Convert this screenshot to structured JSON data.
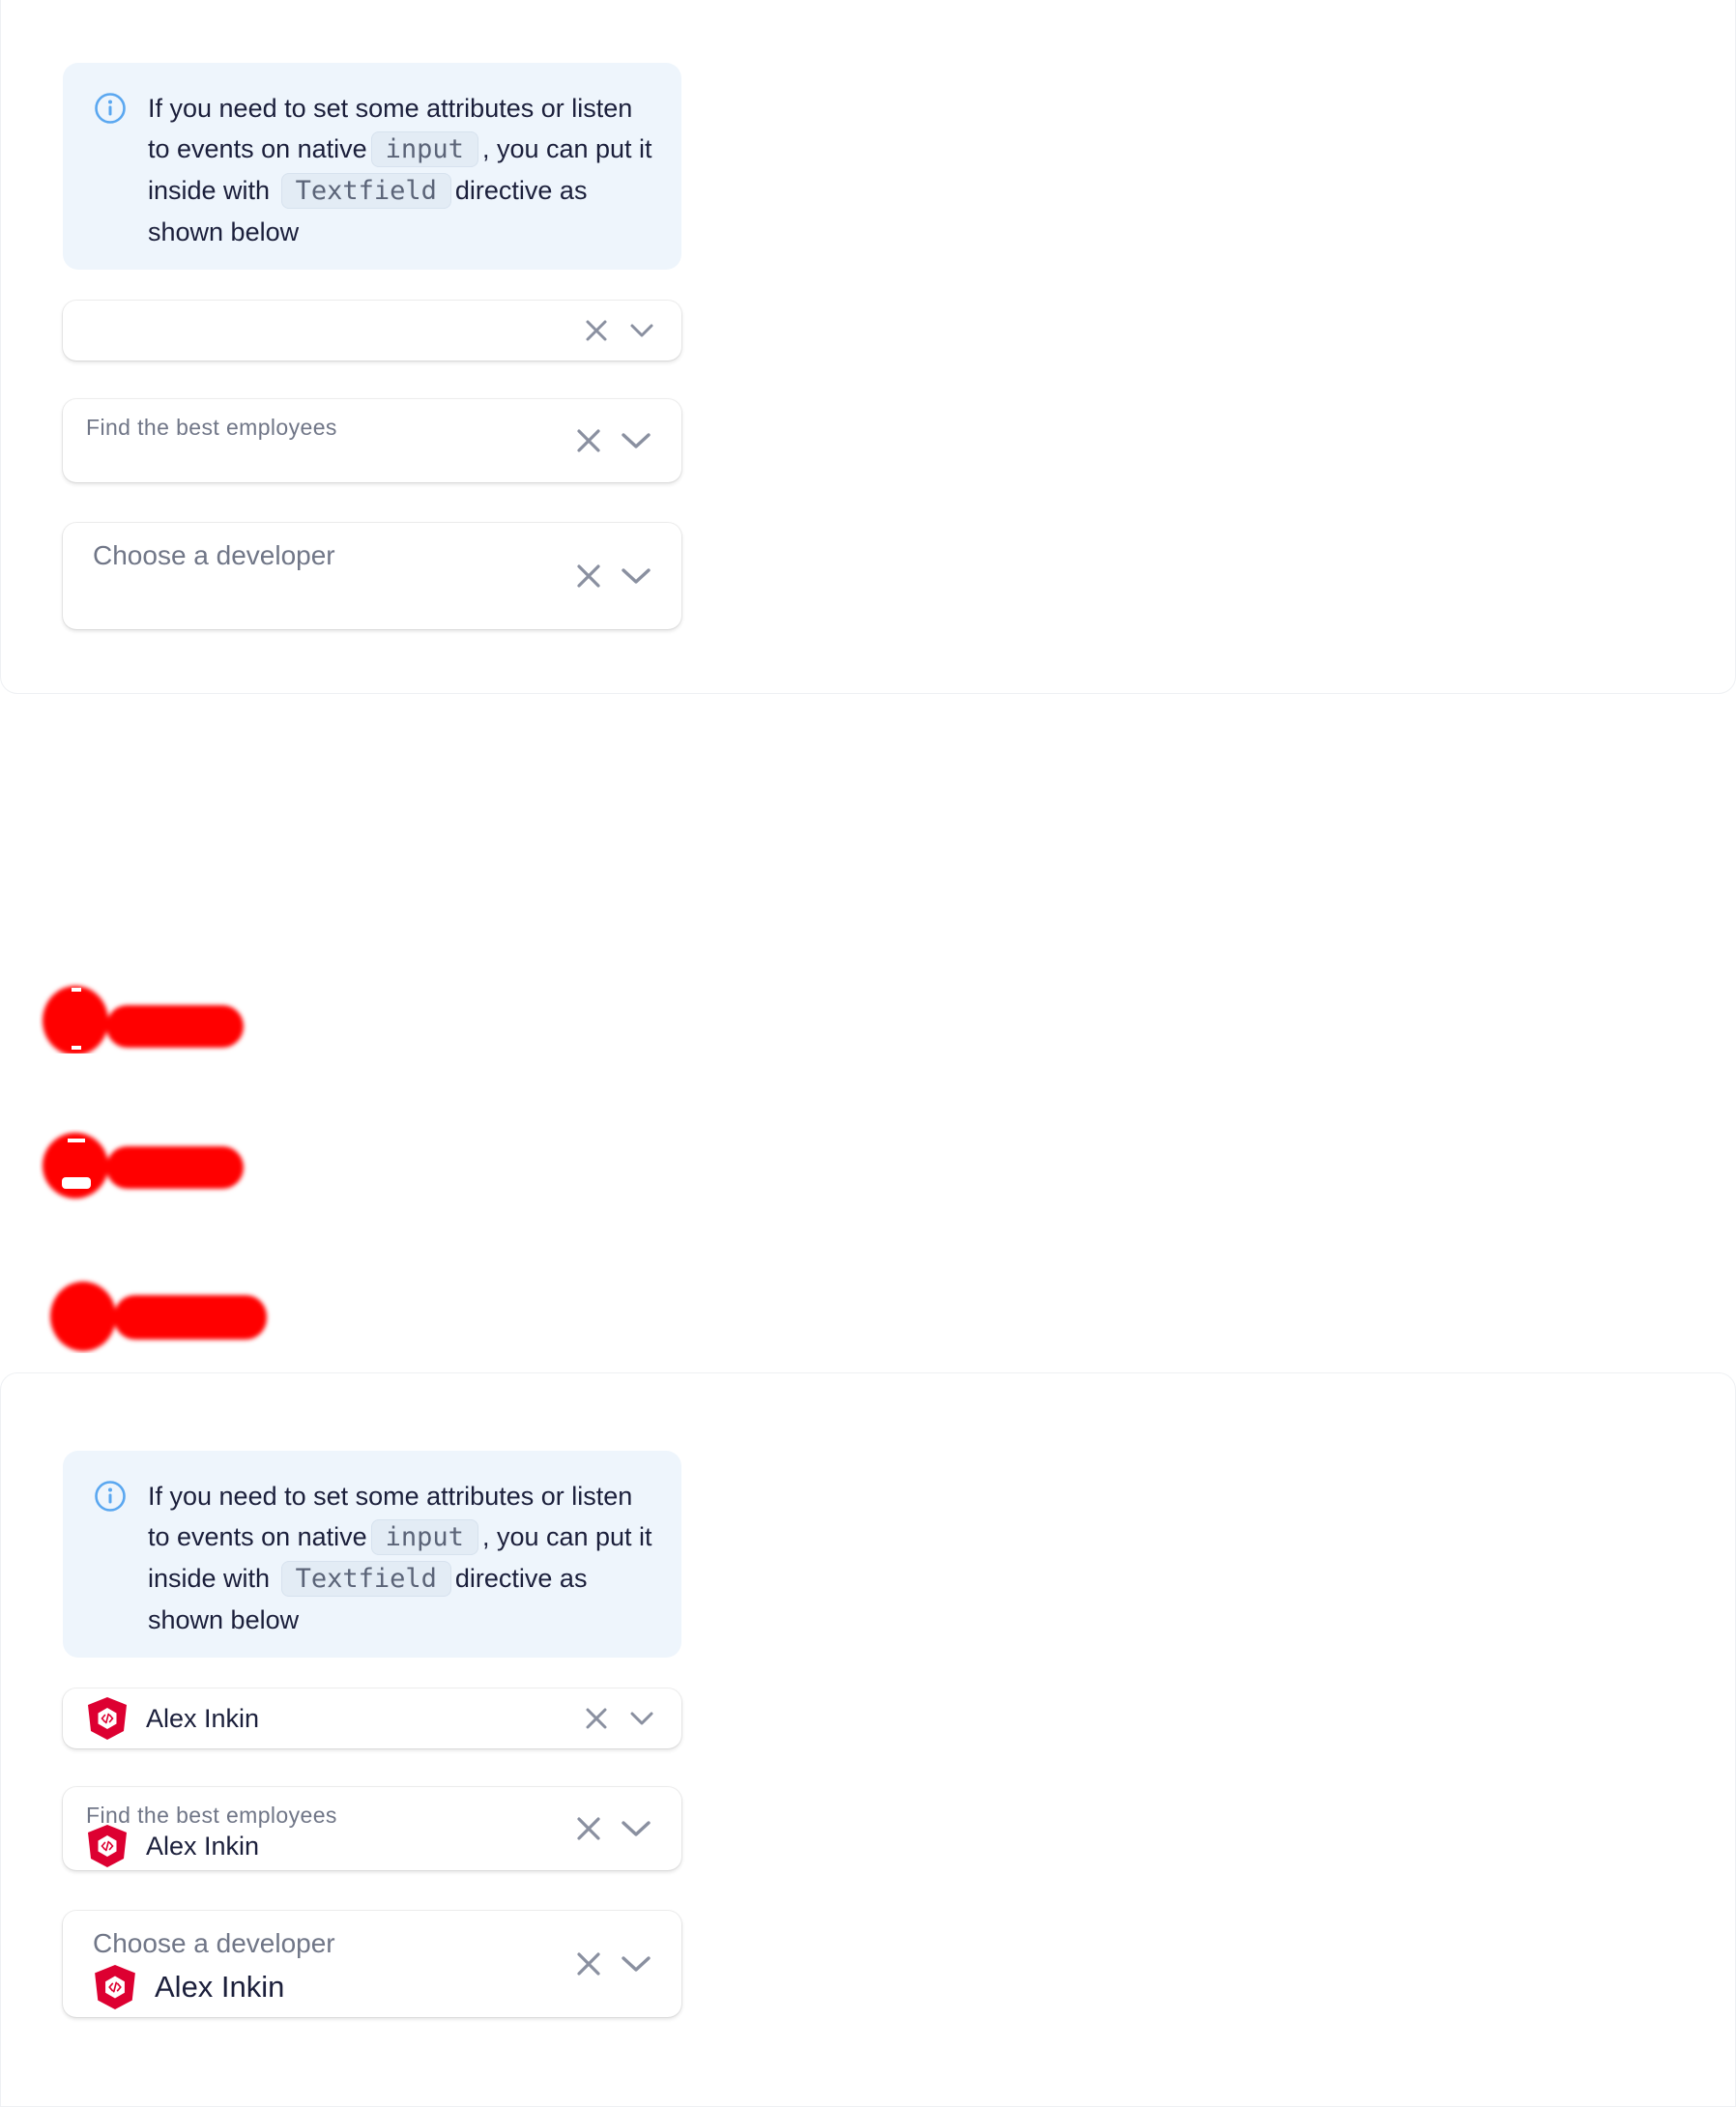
{
  "notice": {
    "text_before_input": "If you need to set some attributes or listen to events on native",
    "input_code": "input",
    "text_after_input": ", you can put it inside with",
    "textfield_code": "Textfield",
    "text_end": "directive as shown below"
  },
  "fields": {
    "small": {
      "value": ""
    },
    "medium": {
      "label": "Find the best employees",
      "value": ""
    },
    "large": {
      "label": "Choose a developer",
      "value": ""
    }
  },
  "fields_filled": {
    "small": {
      "value": "Alex Inkin"
    },
    "medium": {
      "label": "Find the best employees",
      "value": "Alex Inkin"
    },
    "large": {
      "label": "Choose a developer",
      "value": "Alex Inkin"
    }
  },
  "colors": {
    "notice_bg": "#eef5fc",
    "info_icon": "#5aa7f0",
    "avatar_red": "#dd0031",
    "redaction_red": "#ff0000",
    "icon_gray": "#8a90a0"
  },
  "icons": {
    "info": "info-icon",
    "clear": "close-icon",
    "expand": "chevron-down-icon",
    "avatar": "angular-shield-icon"
  }
}
